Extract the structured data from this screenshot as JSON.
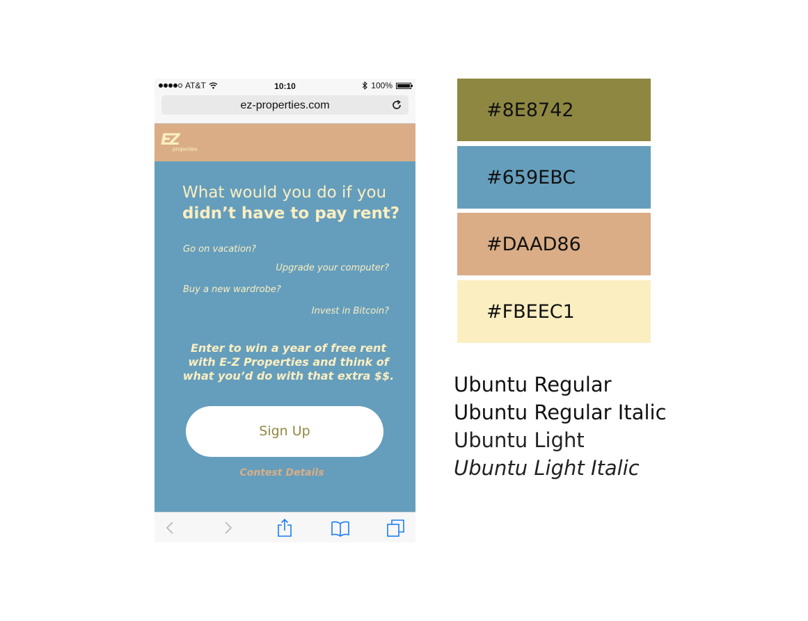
{
  "status_bar": {
    "carrier": "AT&T",
    "time": "10:10",
    "battery": "100%"
  },
  "browser": {
    "url": "ez-properties.com"
  },
  "site": {
    "logo_mark": "EZ",
    "logo_sub": "properties",
    "headline_light": "What would you do if you",
    "headline_bold": "didn’t have to pay rent?",
    "questions": [
      "Go on vacation?",
      "Upgrade your computer?",
      "Buy a new wardrobe?",
      "Invest in Bitcoin?"
    ],
    "promo": "Enter to win a year of free rent with E-Z Properties and think of what you’d do with that extra $$.",
    "signup_label": "Sign Up",
    "contest_label": "Contest Details"
  },
  "palette": [
    {
      "hex_label": "#8E8742",
      "color": "#8E8742"
    },
    {
      "hex_label": "#659EBC",
      "color": "#659EBC"
    },
    {
      "hex_label": "#DAAD86",
      "color": "#DAAD86"
    },
    {
      "hex_label": "#FBEEC1",
      "color": "#FBEEC1"
    }
  ],
  "fonts": [
    "Ubuntu Regular",
    "Ubuntu Regular Italic",
    "Ubuntu Light",
    "Ubuntu Light Italic"
  ],
  "icons": {
    "back": "chevron-left-icon",
    "forward": "chevron-right-icon",
    "share": "share-icon",
    "bookmarks": "book-icon",
    "tabs": "tabs-icon",
    "reload": "reload-icon",
    "wifi": "wifi-icon",
    "bluetooth": "bluetooth-icon"
  }
}
